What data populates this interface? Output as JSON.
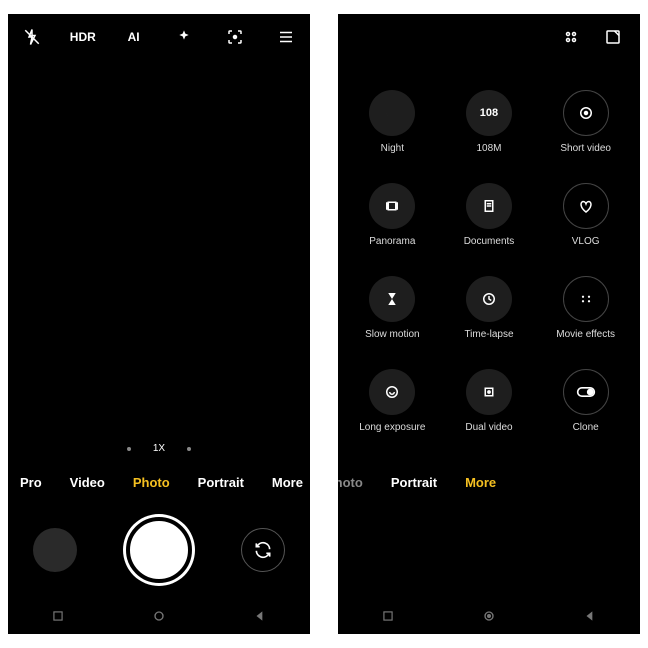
{
  "left": {
    "top": {
      "hdr": "HDR",
      "ai": "AI"
    },
    "zoom_label": "1X",
    "modes": [
      "Pro",
      "Video",
      "Photo",
      "Portrait",
      "More"
    ],
    "active_mode_index": 2
  },
  "right": {
    "grid": [
      {
        "label": "Night",
        "icon": "moon",
        "style": "fill"
      },
      {
        "label": "108M",
        "icon": "text108",
        "style": "fill"
      },
      {
        "label": "Short video",
        "icon": "playcircle",
        "style": "outline"
      },
      {
        "label": "Panorama",
        "icon": "pano",
        "style": "fill"
      },
      {
        "label": "Documents",
        "icon": "doc",
        "style": "fill"
      },
      {
        "label": "VLOG",
        "icon": "heart",
        "style": "outline"
      },
      {
        "label": "Slow motion",
        "icon": "hourglass",
        "style": "fill"
      },
      {
        "label": "Time-lapse",
        "icon": "clock",
        "style": "fill"
      },
      {
        "label": "Movie effects",
        "icon": "dots",
        "style": "outline"
      },
      {
        "label": "Long exposure",
        "icon": "exposure",
        "style": "fill"
      },
      {
        "label": "Dual video",
        "icon": "dual",
        "style": "fill"
      },
      {
        "label": "Clone",
        "icon": "toggle",
        "style": "outline"
      }
    ],
    "modes_cut": "Photo",
    "modes": [
      "Portrait",
      "More"
    ],
    "active_mode": "More",
    "text108": "108"
  }
}
